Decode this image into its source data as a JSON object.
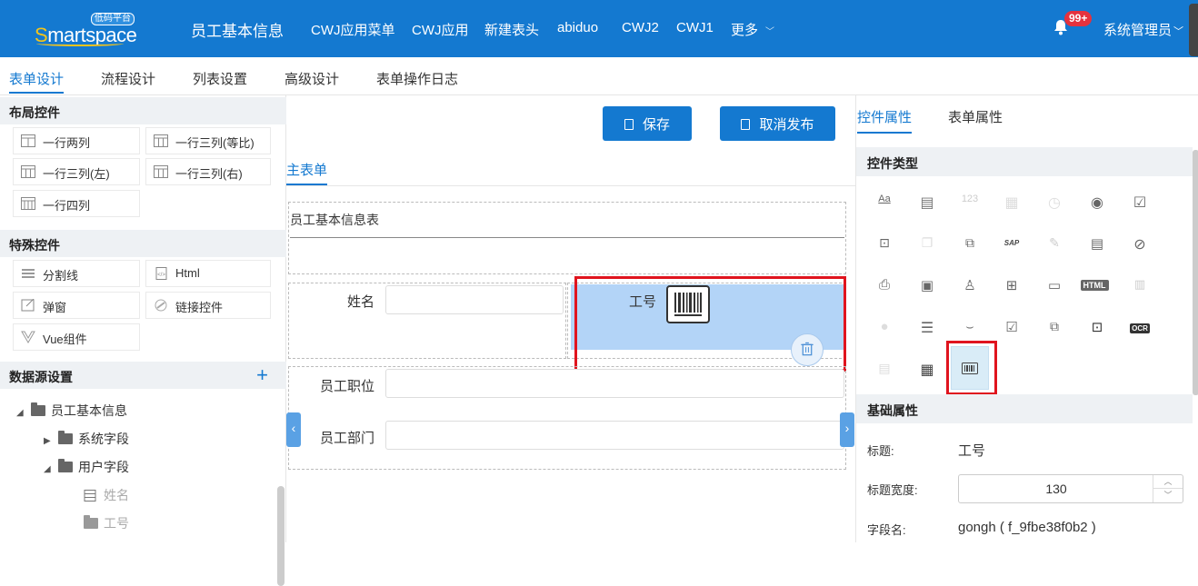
{
  "header": {
    "logo": "Smartspace",
    "logo_tag": "低码平台",
    "app_title": "员工基本信息",
    "nav": [
      "CWJ应用菜单",
      "CWJ应用",
      "新建表头",
      "abiduo",
      "CWJ2",
      "CWJ1",
      "更多"
    ],
    "notifications": "99+",
    "user": "系统管理员"
  },
  "tabs": [
    "表单设计",
    "流程设计",
    "列表设置",
    "高级设计",
    "表单操作日志"
  ],
  "left": {
    "layout_title": "布局控件",
    "layout_items": [
      "一行两列",
      "一行三列(等比)",
      "一行三列(左)",
      "一行三列(右)",
      "一行四列"
    ],
    "special_title": "特殊控件",
    "special_items": [
      "分割线",
      "Html",
      "弹窗",
      "链接控件",
      "Vue组件"
    ],
    "datasource_title": "数据源设置",
    "add": "+",
    "tree": [
      "员工基本信息",
      "系统字段",
      "用户字段",
      "姓名",
      "工号"
    ]
  },
  "center": {
    "save": "保存",
    "unpublish": "取消发布",
    "subtab": "主表单",
    "form_title": "员工基本信息表",
    "fields": {
      "name": "姓名",
      "job_no": "工号",
      "position": "员工职位",
      "dept": "员工部门"
    }
  },
  "right": {
    "tabs": [
      "控件属性",
      "表单属性"
    ],
    "type_title": "控件类型",
    "basic_title": "基础属性",
    "title_label": "标题:",
    "title_value": "工号",
    "width_label": "标题宽度:",
    "width_value": "130",
    "field_label": "字段名:",
    "field_value": "gongh ( f_9fbe38f0b2 )",
    "icon_labels": {
      "aa": "Aa",
      "n123": "123",
      "sap": "SAP",
      "html": "HTML",
      "ocr": "OCR"
    }
  },
  "colors": {
    "brand": "#1479d0",
    "highlight": "#e0141e",
    "selected": "#b3d4f7"
  }
}
